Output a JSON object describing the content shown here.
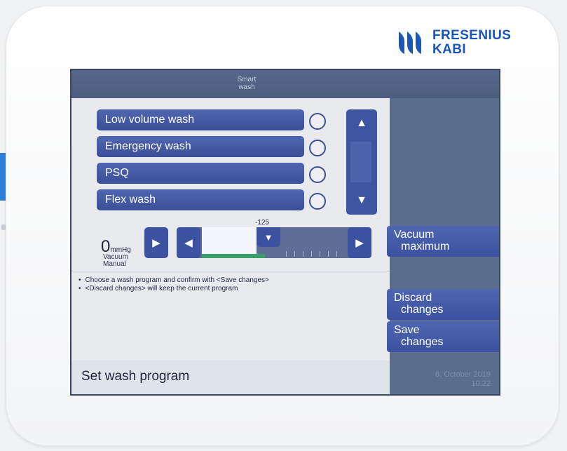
{
  "brand": {
    "line1": "FRESENIUS",
    "line2": "KABI",
    "color": "#1a56b7"
  },
  "header": {
    "title_line1": "Smart",
    "title_line2": "wash"
  },
  "programs": [
    {
      "label": "Low volume wash",
      "selected": false
    },
    {
      "label": "Emergency wash",
      "selected": false
    },
    {
      "label": "PSQ",
      "selected": false
    },
    {
      "label": "Flex wash",
      "selected": false
    }
  ],
  "scroll": {
    "up_icon": "chevron-up-icon",
    "down_icon": "chevron-down-icon"
  },
  "vacuum": {
    "value": "0",
    "unit": "mmHg",
    "label_line1": "Vacuum",
    "label_line2": "Manual",
    "slider_marker": "-125"
  },
  "hints": [
    "Choose a wash program and confirm with <Save changes>",
    "<Discard changes> will keep the current program"
  ],
  "side_buttons": {
    "vacuum_line1": "Vacuum",
    "vacuum_line2": "maximum",
    "discard_line1": "Discard",
    "discard_line2": "changes",
    "save_line1": "Save",
    "save_line2": "changes"
  },
  "footer": {
    "title": "Set wash program"
  },
  "status": {
    "date": "8. October 2019",
    "time": "10:22"
  },
  "colors": {
    "accent": "#3b52a0",
    "screen_bg": "#5b6d8d",
    "slider_green": "#3b9e6a"
  }
}
